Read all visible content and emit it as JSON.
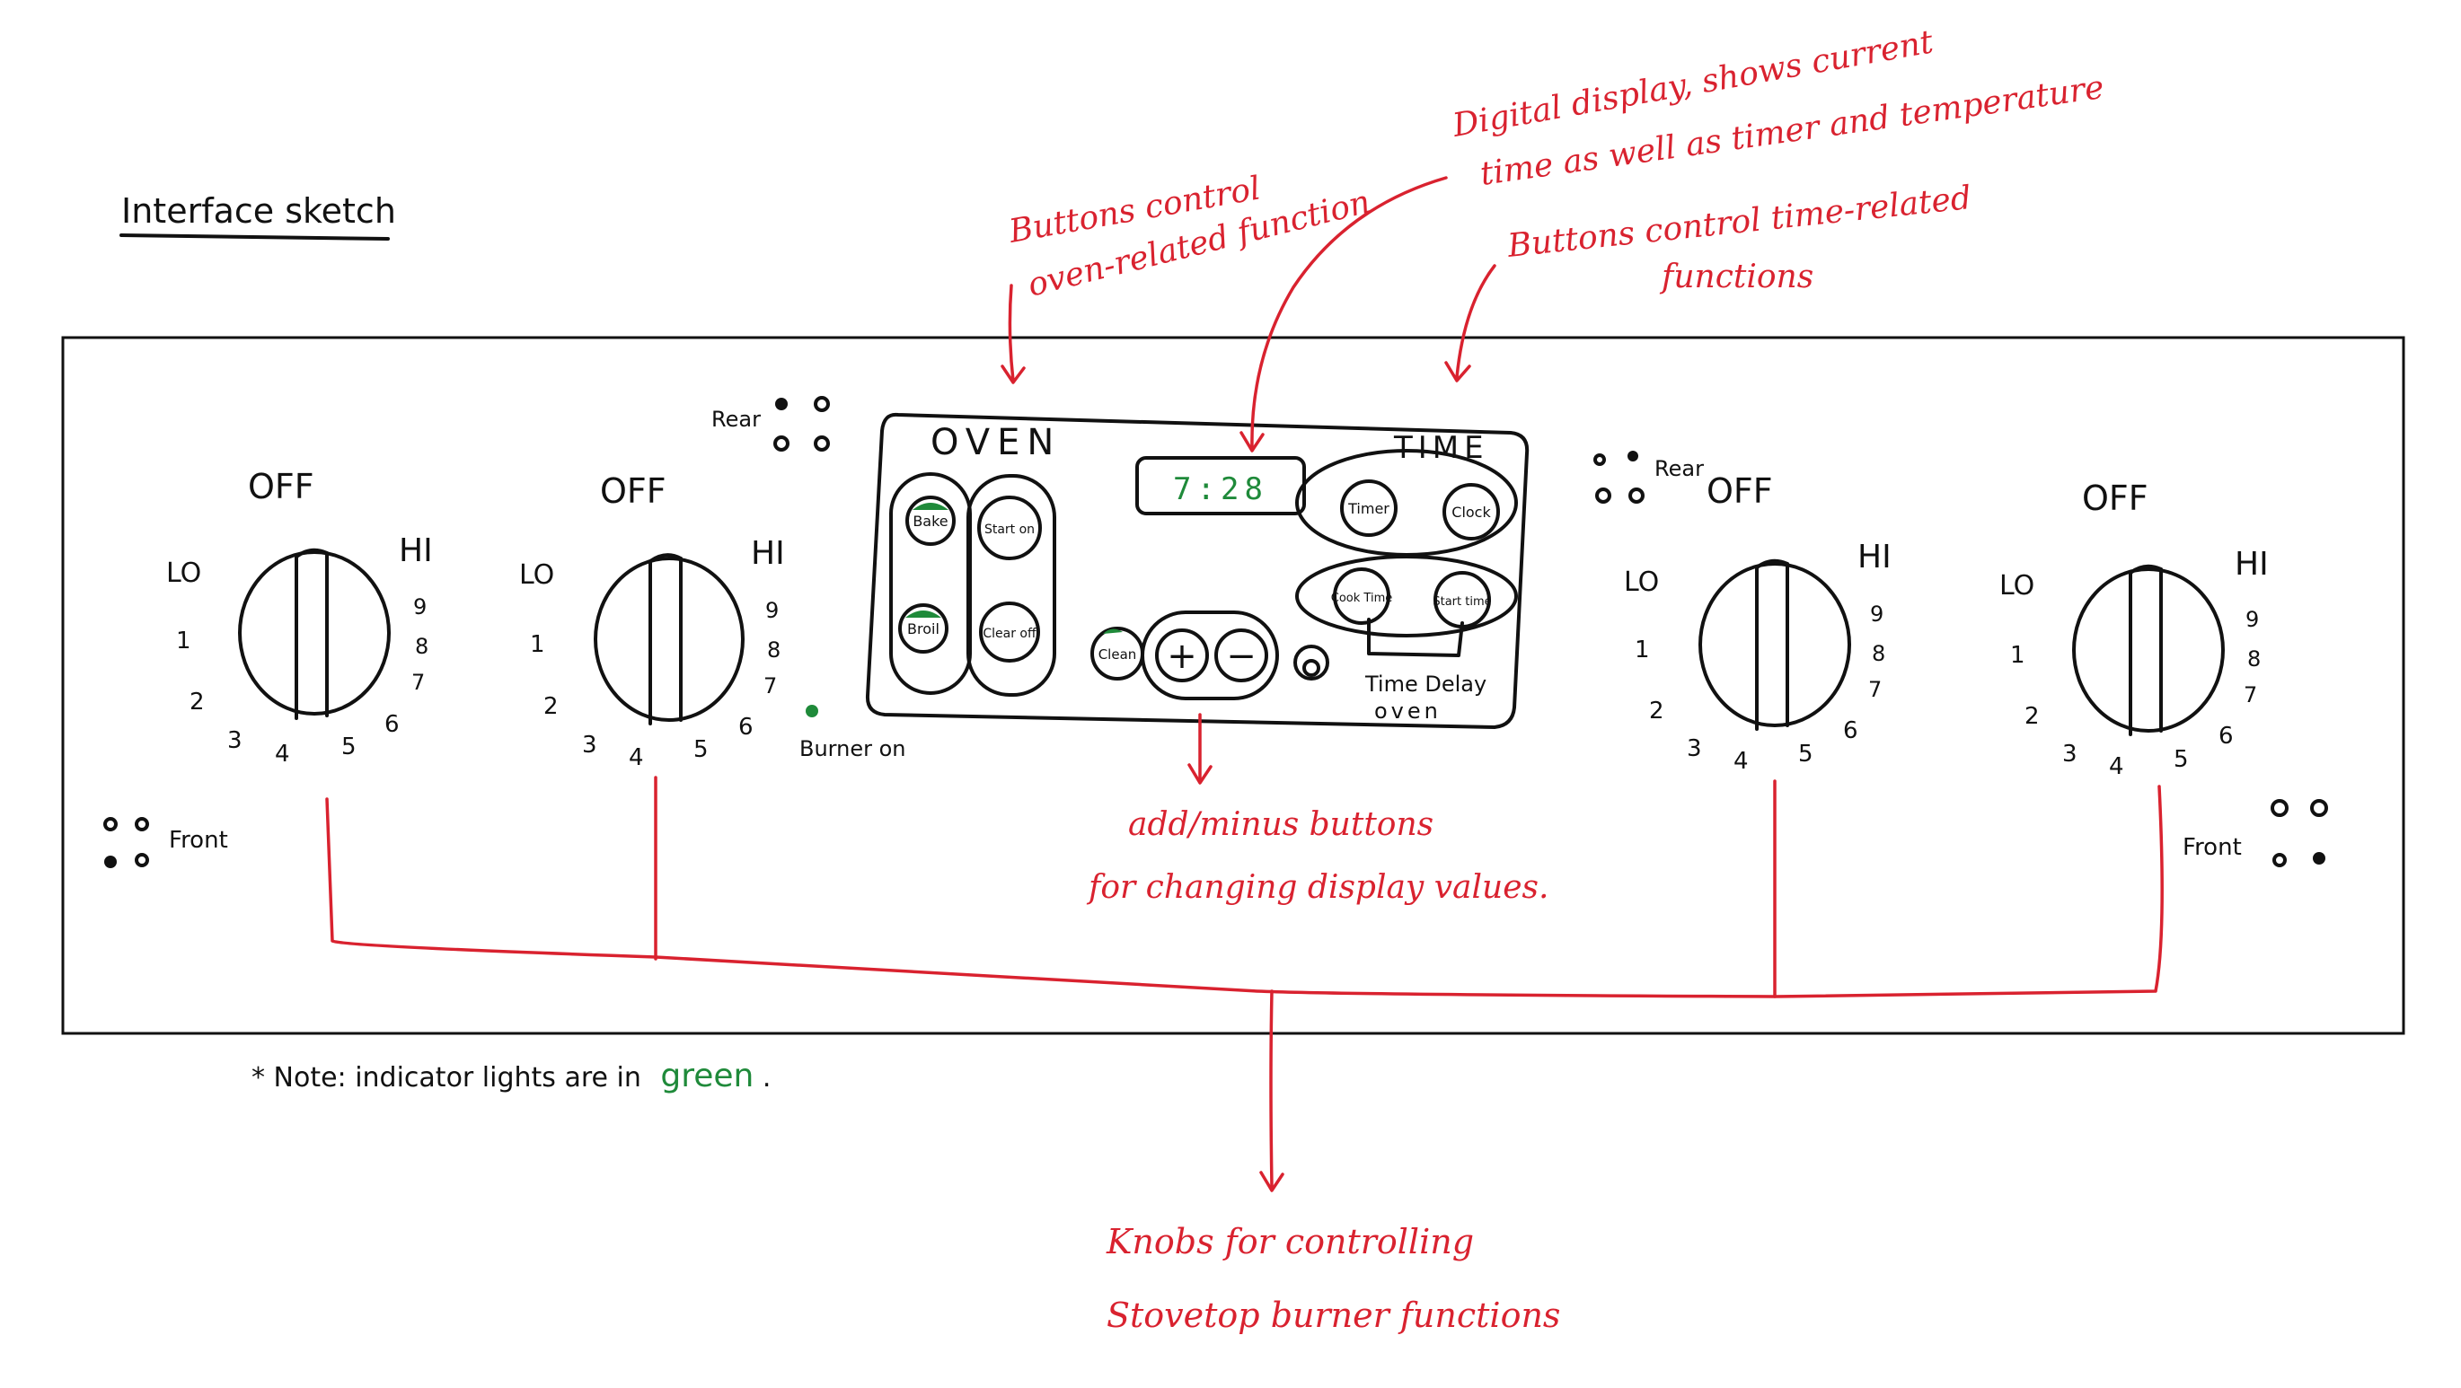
{
  "title": "Interface sketch",
  "note": {
    "prefix": "* Note: indicator lights are in",
    "highlight": "green",
    "suffix": "."
  },
  "colors": {
    "ink": "#111111",
    "annotation": "#d9222f",
    "indicator": "#1f8a3a"
  },
  "knob_labels": {
    "off": "OFF",
    "lo": "LO",
    "hi": "HI",
    "n1": "1",
    "n2": "2",
    "n3": "3",
    "n4": "4",
    "n5": "5",
    "n6": "6",
    "n7": "7",
    "n8": "8",
    "n9": "9"
  },
  "burner_labels": {
    "rear": "Rear",
    "front": "Front",
    "burner_on": "Burner on"
  },
  "oven_panel": {
    "oven_title": "OVEN",
    "time_title": "TIME",
    "display_value": "7:28",
    "buttons": {
      "bake": "Bake",
      "broil": "Broil",
      "start_on": "Start on",
      "clear_off": "Clear off",
      "clean": "Clean",
      "plus": "+",
      "minus": "−",
      "timer": "Timer",
      "clock": "Clock",
      "cook_time": "Cook Time",
      "start_time": "Start time"
    },
    "time_delay_label": "Time Delay",
    "time_delay_sub": "oven"
  },
  "annotations": {
    "oven_buttons_1": "Buttons control",
    "oven_buttons_2": "oven-related function",
    "display_1": "Digital display, shows current",
    "display_2": "time as well as timer and temperature",
    "time_buttons_1": "Buttons control time-related",
    "time_buttons_2": "functions",
    "add_minus_1": "add/minus buttons",
    "add_minus_2": "for changing display values.",
    "knobs_1": "Knobs for controlling",
    "knobs_2": "Stovetop burner functions"
  }
}
